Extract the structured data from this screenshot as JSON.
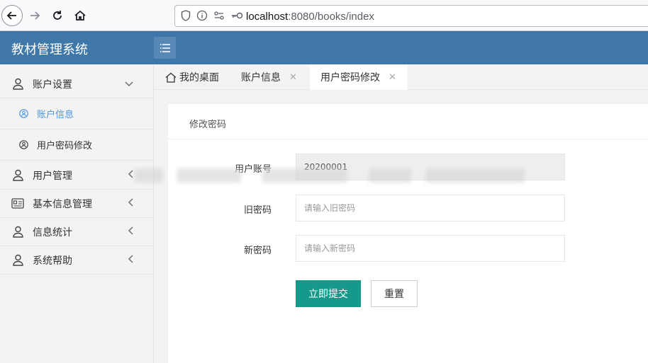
{
  "browser": {
    "url_host": "localhost",
    "url_rest": ":8080/books/index"
  },
  "header": {
    "app_title": "教材管理系统"
  },
  "sidebar": {
    "items": [
      {
        "label": "账户设置",
        "icon": "user-icon",
        "arrow": "chevron-down-icon",
        "expanded": true,
        "children": [
          {
            "label": "账户信息",
            "icon": "user-circle-icon",
            "active": true
          },
          {
            "label": "用户密码修改",
            "icon": "user-circle-icon",
            "active": false
          }
        ]
      },
      {
        "label": "用户管理",
        "icon": "user-icon",
        "arrow": "chevron-left-icon"
      },
      {
        "label": "基本信息管理",
        "icon": "id-card-icon",
        "arrow": "chevron-left-icon"
      },
      {
        "label": "信息统计",
        "icon": "user-icon",
        "arrow": "chevron-left-icon"
      },
      {
        "label": "系统帮助",
        "icon": "user-icon",
        "arrow": "chevron-left-icon"
      }
    ]
  },
  "tabs": [
    {
      "label": "我的桌面",
      "icon": "home-icon",
      "closable": false,
      "active": false
    },
    {
      "label": "账户信息",
      "closable": true,
      "close": "✕",
      "active": false
    },
    {
      "label": "用户密码修改",
      "closable": true,
      "close": "✕",
      "active": true
    }
  ],
  "form": {
    "title": "修改密码",
    "account_label": "用户账号",
    "account_value": "20200001",
    "old_label": "旧密码",
    "old_placeholder": "请输入旧密码",
    "new_label": "新密码",
    "new_placeholder": "请输入新密码",
    "submit_label": "立即提交",
    "reset_label": "重置"
  },
  "colors": {
    "header": "#3e77a8",
    "primary_button": "#16998a",
    "active_link": "#4e96e0"
  }
}
